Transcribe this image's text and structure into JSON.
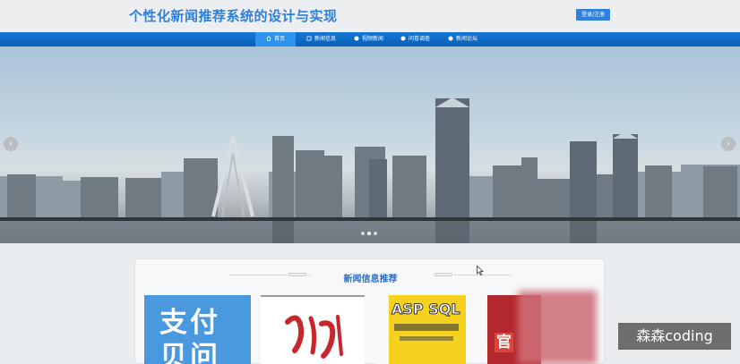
{
  "header": {
    "title": "个性化新闻推荐系统的设计与实现",
    "login_label": "登录/注册"
  },
  "nav": {
    "items": [
      {
        "label": "首页",
        "icon": "home-icon",
        "active": true
      },
      {
        "label": "新闻信息",
        "icon": "news-icon",
        "active": false
      },
      {
        "label": "视频新闻",
        "icon": "video-icon",
        "active": false
      },
      {
        "label": "问卷调查",
        "icon": "survey-icon",
        "active": false
      },
      {
        "label": "新闻论坛",
        "icon": "forum-icon",
        "active": false
      }
    ]
  },
  "banner": {
    "prev_icon": "chevron-left-icon",
    "next_icon": "chevron-right-icon",
    "prev_glyph": "‹",
    "next_glyph": "›",
    "slide_count": 3,
    "active_slide": 2
  },
  "recommend": {
    "section_title": "新闻信息推荐",
    "cards": [
      {
        "text": "支付\n贝问"
      },
      {
        "text": ""
      },
      {
        "text": "ASP SQL"
      },
      {
        "text": "官"
      }
    ]
  },
  "watermark": "森森coding",
  "colors": {
    "accent": "#2f7fdc",
    "nav_bg": "#0b68c6",
    "nav_active": "#2d93ee",
    "section_title": "#2a6fc5"
  }
}
